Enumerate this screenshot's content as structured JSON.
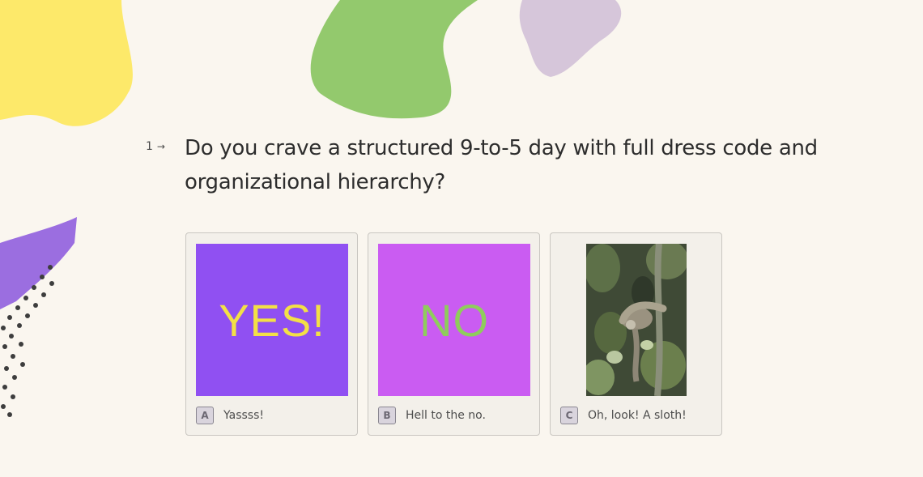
{
  "colors": {
    "background": "#faf6ef",
    "blob_yellow": "#fde96a",
    "blob_green": "#93c96d",
    "blob_lavender": "#d6c6da",
    "blob_purple": "#9b6ee0",
    "dots": "#3d3d3d",
    "choice_yes_bg": "#9050f2",
    "choice_no_bg": "#ca5cf2"
  },
  "question": {
    "number": "1",
    "arrow_icon": "arrow-right-icon",
    "text": "Do you crave a structured 9-to-5 day with full dress code and organizational hierarchy?"
  },
  "choices": [
    {
      "key": "A",
      "image_text": "YES!",
      "label": "Yassss!"
    },
    {
      "key": "B",
      "image_text": "NO",
      "label": "Hell to the no."
    },
    {
      "key": "C",
      "image_icon": "sloth-image",
      "label": "Oh, look! A sloth!"
    }
  ]
}
